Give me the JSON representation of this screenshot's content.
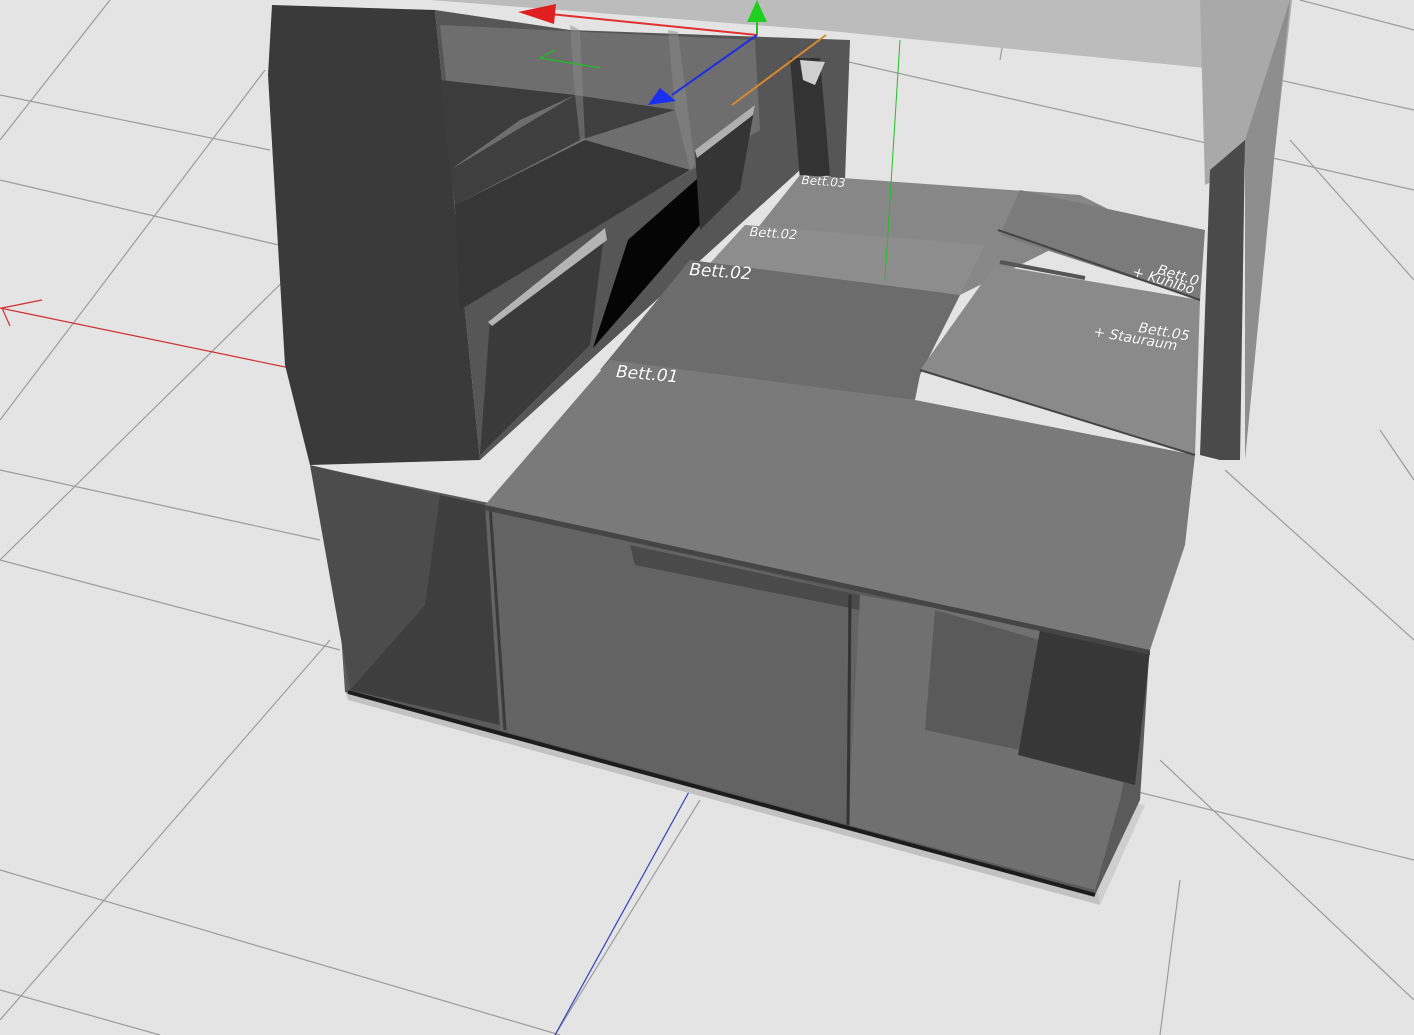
{
  "viewport": {
    "labels": {
      "bett01": "Bett.01",
      "bett02_front": "Bett.02",
      "bett02_back": "Bett.02",
      "bett03": "Bett.03",
      "bett04": "Bett.0",
      "bett04_sub": "+ Kühlbo",
      "bett05": "Bett.05",
      "bett05_sub": "+ Stauraum"
    },
    "gizmo": {
      "x_axis_color": "#e02020",
      "y_axis_color": "#20c020",
      "z_axis_color": "#2030e0"
    },
    "colors": {
      "background": "#e4e4e4",
      "grid_line": "#9a9a9a",
      "cabinet_dark": "#3a3a3a",
      "panel_mid": "#6a6a6a",
      "panel_light": "#7c7c7c",
      "roof": "#bdbdbd"
    }
  }
}
